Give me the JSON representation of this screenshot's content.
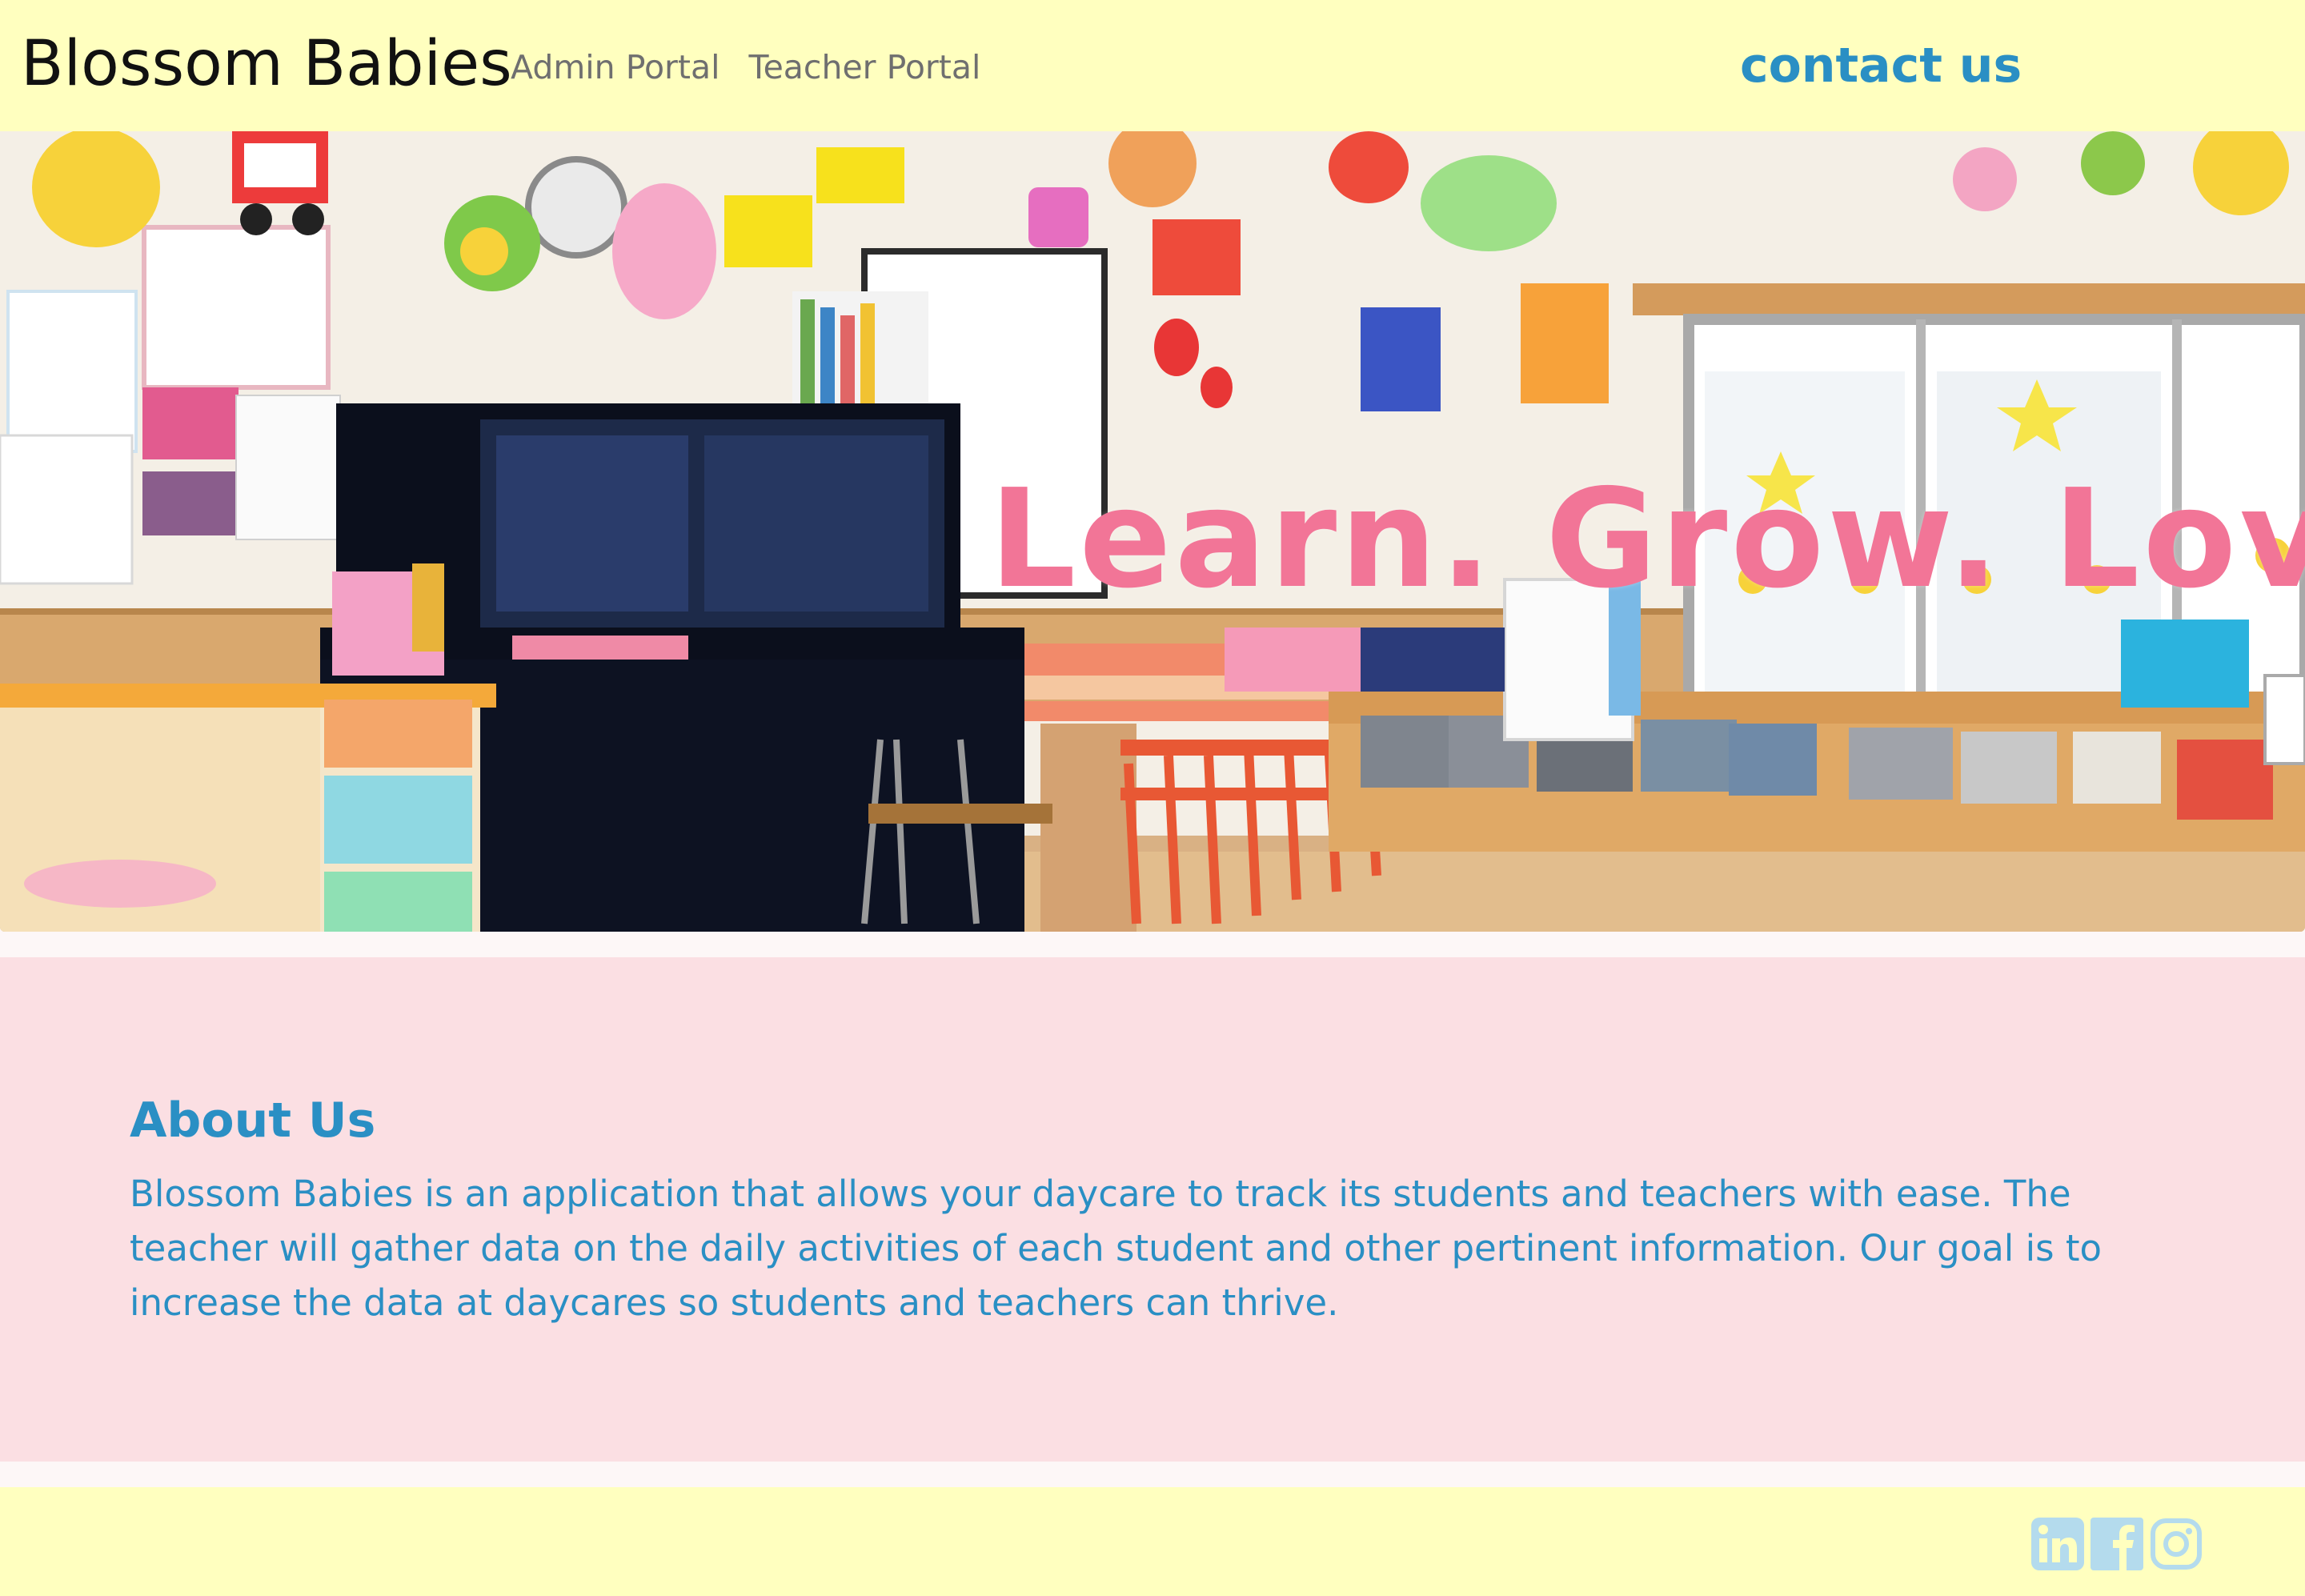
{
  "header": {
    "brand": "Blossom Babies",
    "nav_links": [
      {
        "label": "Admin Portal"
      },
      {
        "label": "Teacher Portal"
      }
    ],
    "contact_label": "contact us"
  },
  "hero": {
    "tagline": "Learn. Grow. Love.",
    "image_description_icon": "classroom-photo"
  },
  "about": {
    "title": "About Us",
    "body": "Blossom Babies is an application that allows your daycare to track its students and teachers with ease. The teacher will gather data on the daily activities of each student and other pertinent information. Our goal is to increase the data at daycares so students and teachers can thrive."
  },
  "footer": {
    "social_icons": [
      "linkedin-icon",
      "facebook-icon",
      "instagram-icon"
    ]
  },
  "colors": {
    "header_bg": "#ffffbf",
    "accent_blue": "#2a8fc4",
    "tagline_pink": "#f27597",
    "about_bg": "#fbdfe3",
    "social_icon": "#b4dbed"
  }
}
